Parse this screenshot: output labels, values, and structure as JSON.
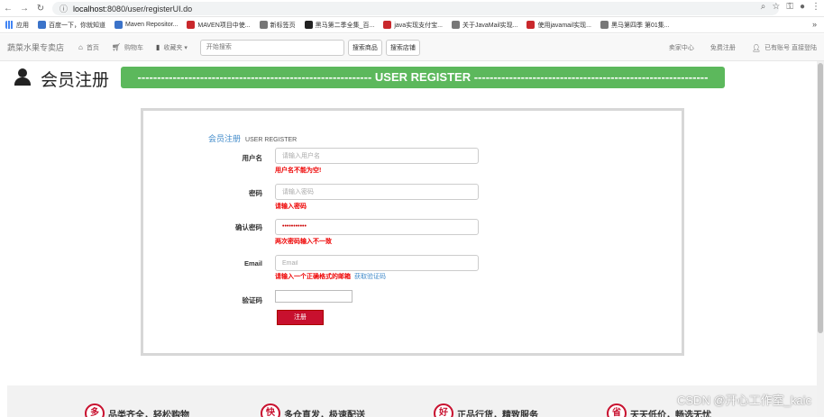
{
  "browser": {
    "url_host": "localhost",
    "url_rest": ":8080/user/registerUI.do",
    "bookmarks": [
      {
        "label": "应用",
        "color": "grid"
      },
      {
        "label": "百度一下，你就知道",
        "color": "blue"
      },
      {
        "label": "Maven Repositor...",
        "color": "blue"
      },
      {
        "label": "MAVEN项目中使...",
        "color": "red"
      },
      {
        "label": "新标签页",
        "color": "globe"
      },
      {
        "label": "黑马第二季全集_百...",
        "color": "dark"
      },
      {
        "label": "java实现支付宝...",
        "color": "red"
      },
      {
        "label": "关于JavaMail实现...",
        "color": "globe"
      },
      {
        "label": "使用javamail实现...",
        "color": "red"
      },
      {
        "label": "黑马第四季 第01集...",
        "color": "globe"
      }
    ]
  },
  "site": {
    "brand": "蔬菜水果专卖店",
    "nav": {
      "home": "首页",
      "cart": "购物车",
      "favorites": "收藏夹",
      "search_placeholder": "开始搜索",
      "search_goods": "搜索商品",
      "search_shop": "搜索店铺",
      "seller_center": "卖家中心",
      "free_register": "免费注册",
      "login": "已有账号 直接登陆"
    }
  },
  "header": {
    "title": "会员注册",
    "banner": "------------------------------------------------------------ USER REGISTER ------------------------------------------------------------"
  },
  "form": {
    "legend_cn": "会员注册",
    "legend_en": "USER REGISTER",
    "username": {
      "label": "用户名",
      "placeholder": "请输入用户名",
      "value": "",
      "error": "用户名不能为空!"
    },
    "password": {
      "label": "密码",
      "placeholder": "请输入密码",
      "value": "",
      "error": "请输入密码"
    },
    "confirm": {
      "label": "确认密码",
      "value": "•••••••••••",
      "error": "两次密码输入不一致"
    },
    "email": {
      "label": "Email",
      "placeholder": "Email",
      "value": "",
      "error": "请输入一个正确格式的邮箱",
      "get_code": "获取验证码"
    },
    "captcha": {
      "label": "验证码"
    },
    "submit": "注册"
  },
  "footer": {
    "features": [
      {
        "badge": "多",
        "text": "品类齐全，轻松购物"
      },
      {
        "badge": "快",
        "text": "多仓直发，极速配送"
      },
      {
        "badge": "好",
        "text": "正品行货，精致服务"
      },
      {
        "badge": "省",
        "text": "天天低价，畅选无忧"
      }
    ]
  },
  "watermark": "CSDN @开心工作室_kaic",
  "colors": {
    "banner_green": "#5cb85c",
    "submit_red": "#c8102e",
    "error_red": "#e00000",
    "link_blue": "#428bca"
  }
}
